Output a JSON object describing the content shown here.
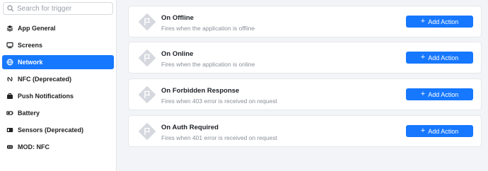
{
  "search": {
    "placeholder": "Search for trigger",
    "value": ""
  },
  "sidebar": {
    "items": [
      {
        "label": "App General",
        "icon": "layers-icon"
      },
      {
        "label": "Screens",
        "icon": "monitor-icon"
      },
      {
        "label": "Network",
        "icon": "globe-icon",
        "active": true
      },
      {
        "label": "NFC (Deprecated)",
        "icon": "nfc-icon"
      },
      {
        "label": "Push Notifications",
        "icon": "briefcase-icon"
      },
      {
        "label": "Battery",
        "icon": "battery-icon"
      },
      {
        "label": "Sensors (Deprecated)",
        "icon": "sensor-icon"
      },
      {
        "label": "MOD: NFC",
        "icon": "mod-icon"
      }
    ]
  },
  "triggers": [
    {
      "title": "On Offline",
      "description": "Fires when the application is offline",
      "button": "Add Action"
    },
    {
      "title": "On Online",
      "description": "Fires when the application is online",
      "button": "Add Action"
    },
    {
      "title": "On Forbidden Response",
      "description": "Fires when 403 error is received on request",
      "button": "Add Action"
    },
    {
      "title": "On Auth Required",
      "description": "Fires when 401 error is received on request",
      "button": "Add Action"
    }
  ],
  "colors": {
    "accent": "#1677ff",
    "icon_bg": "#d5d8de",
    "page_bg": "#f3f4f7"
  }
}
